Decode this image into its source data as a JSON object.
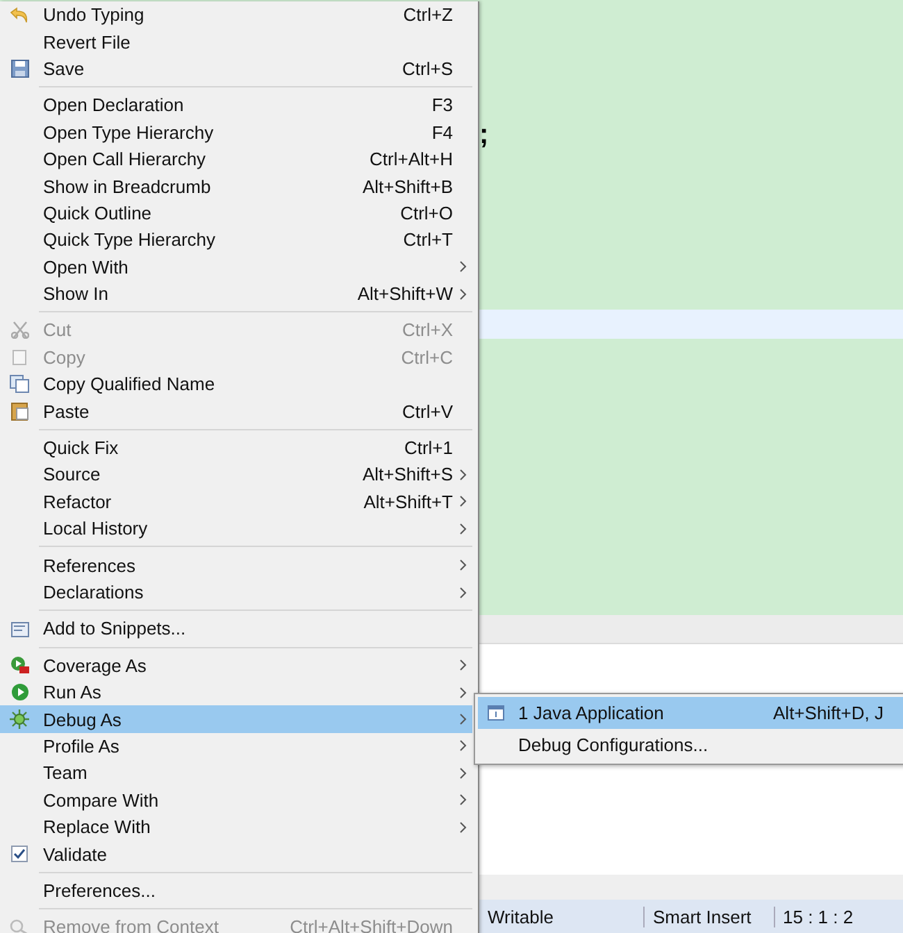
{
  "editor": {
    "code_fragment": ";"
  },
  "status_bar": [
    "Writable",
    "Smart Insert",
    "15 : 1 : 2"
  ],
  "context_menu": {
    "groups": [
      [
        {
          "label": "Undo Typing",
          "shortcut": "Ctrl+Z",
          "submenu": false,
          "disabled": false,
          "selected": false
        },
        {
          "label": "Revert File",
          "submenu": false,
          "disabled": false,
          "selected": false
        },
        {
          "label": "Save",
          "shortcut": "Ctrl+S",
          "submenu": false,
          "disabled": false,
          "selected": false
        }
      ],
      [
        {
          "label": "Open Declaration",
          "shortcut": "F3",
          "submenu": false,
          "disabled": false,
          "selected": false
        },
        {
          "label": "Open Type Hierarchy",
          "shortcut": "F4",
          "submenu": false,
          "disabled": false,
          "selected": false
        },
        {
          "label": "Open Call Hierarchy",
          "shortcut": "Ctrl+Alt+H",
          "submenu": false,
          "disabled": false,
          "selected": false
        },
        {
          "label": "Show in Breadcrumb",
          "shortcut": "Alt+Shift+B",
          "submenu": false,
          "disabled": false,
          "selected": false
        },
        {
          "label": "Quick Outline",
          "shortcut": "Ctrl+O",
          "submenu": false,
          "disabled": false,
          "selected": false
        },
        {
          "label": "Quick Type Hierarchy",
          "shortcut": "Ctrl+T",
          "submenu": false,
          "disabled": false,
          "selected": false
        },
        {
          "label": "Open With",
          "submenu": true,
          "disabled": false,
          "selected": false
        },
        {
          "label": "Show In",
          "shortcut": "Alt+Shift+W",
          "submenu": true,
          "disabled": false,
          "selected": false
        }
      ],
      [
        {
          "label": "Cut",
          "shortcut": "Ctrl+X",
          "submenu": false,
          "disabled": true,
          "selected": false
        },
        {
          "label": "Copy",
          "shortcut": "Ctrl+C",
          "submenu": false,
          "disabled": true,
          "selected": false
        },
        {
          "label": "Copy Qualified Name",
          "submenu": false,
          "disabled": false,
          "selected": false
        },
        {
          "label": "Paste",
          "shortcut": "Ctrl+V",
          "submenu": false,
          "disabled": false,
          "selected": false
        }
      ],
      [
        {
          "label": "Quick Fix",
          "shortcut": "Ctrl+1",
          "submenu": false,
          "disabled": false,
          "selected": false
        },
        {
          "label": "Source",
          "shortcut": "Alt+Shift+S",
          "submenu": true,
          "disabled": false,
          "selected": false
        },
        {
          "label": "Refactor",
          "shortcut": "Alt+Shift+T",
          "submenu": true,
          "disabled": false,
          "selected": false
        },
        {
          "label": "Local History",
          "submenu": true,
          "disabled": false,
          "selected": false
        }
      ],
      [
        {
          "label": "References",
          "submenu": true,
          "disabled": false,
          "selected": false
        },
        {
          "label": "Declarations",
          "submenu": true,
          "disabled": false,
          "selected": false
        }
      ],
      [
        {
          "label": "Add to Snippets...",
          "submenu": false,
          "disabled": false,
          "selected": false
        }
      ],
      [
        {
          "label": "Coverage As",
          "submenu": true,
          "disabled": false,
          "selected": false
        },
        {
          "label": "Run As",
          "submenu": true,
          "disabled": false,
          "selected": false
        },
        {
          "label": "Debug As",
          "submenu": true,
          "disabled": false,
          "selected": true
        },
        {
          "label": "Profile As",
          "submenu": true,
          "disabled": false,
          "selected": false
        },
        {
          "label": "Team",
          "submenu": true,
          "disabled": false,
          "selected": false
        },
        {
          "label": "Compare With",
          "submenu": true,
          "disabled": false,
          "selected": false
        },
        {
          "label": "Replace With",
          "submenu": true,
          "disabled": false,
          "selected": false
        },
        {
          "label": "Validate",
          "submenu": false,
          "disabled": false,
          "selected": false,
          "checked": true
        }
      ],
      [
        {
          "label": "Preferences...",
          "submenu": false,
          "disabled": false,
          "selected": false
        }
      ],
      [
        {
          "label": "Remove from Context",
          "shortcut": "Ctrl+Alt+Shift+Down",
          "submenu": false,
          "disabled": true,
          "selected": false
        }
      ]
    ]
  },
  "submenu": {
    "items": [
      {
        "label": "1 Java Application",
        "shortcut": "Alt+Shift+D, J",
        "selected": true
      },
      {
        "label": "Debug Configurations...",
        "selected": false
      }
    ]
  }
}
